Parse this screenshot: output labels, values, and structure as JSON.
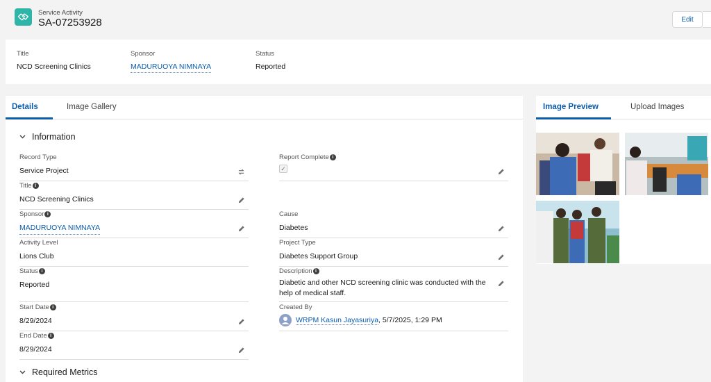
{
  "header": {
    "object_label": "Service Activity",
    "record_name": "SA-07253928",
    "edit_label": "Edit"
  },
  "highlights": [
    {
      "label": "Title",
      "value": "NCD Screening Clinics"
    },
    {
      "label": "Sponsor",
      "value": "MADURUOYA NIMNAYA"
    },
    {
      "label": "Status",
      "value": "Reported"
    }
  ],
  "tabs": {
    "details": "Details",
    "gallery": "Image Gallery"
  },
  "sections": {
    "information": "Information",
    "required_metrics": "Required Metrics"
  },
  "fields": {
    "record_type": {
      "label": "Record Type",
      "value": "Service Project"
    },
    "report_complete": {
      "label": "Report Complete",
      "checked": true
    },
    "title": {
      "label": "Title",
      "value": "NCD Screening Clinics"
    },
    "sponsor": {
      "label": "Sponsor",
      "value": "MADURUOYA NIMNAYA"
    },
    "cause": {
      "label": "Cause",
      "value": "Diabetes"
    },
    "activity_level": {
      "label": "Activity Level",
      "value": "Lions Club"
    },
    "project_type": {
      "label": "Project Type",
      "value": "Diabetes Support Group"
    },
    "status": {
      "label": "Status",
      "value": "Reported"
    },
    "description": {
      "label": "Description",
      "value": "Diabetic and other NCD screening clinic was conducted with the help of medical staff."
    },
    "start_date": {
      "label": "Start Date",
      "value": "8/29/2024"
    },
    "created_by": {
      "label": "Created By",
      "user": "WRPM Kasun Jayasuriya",
      "datetime": ", 5/7/2025, 1:29 PM"
    },
    "end_date": {
      "label": "End Date",
      "value": "8/29/2024"
    }
  },
  "right_tabs": {
    "preview": "Image Preview",
    "upload": "Upload Images"
  },
  "colors": {
    "brand": "#0b5cab",
    "record_icon": "#2fb5a7"
  }
}
